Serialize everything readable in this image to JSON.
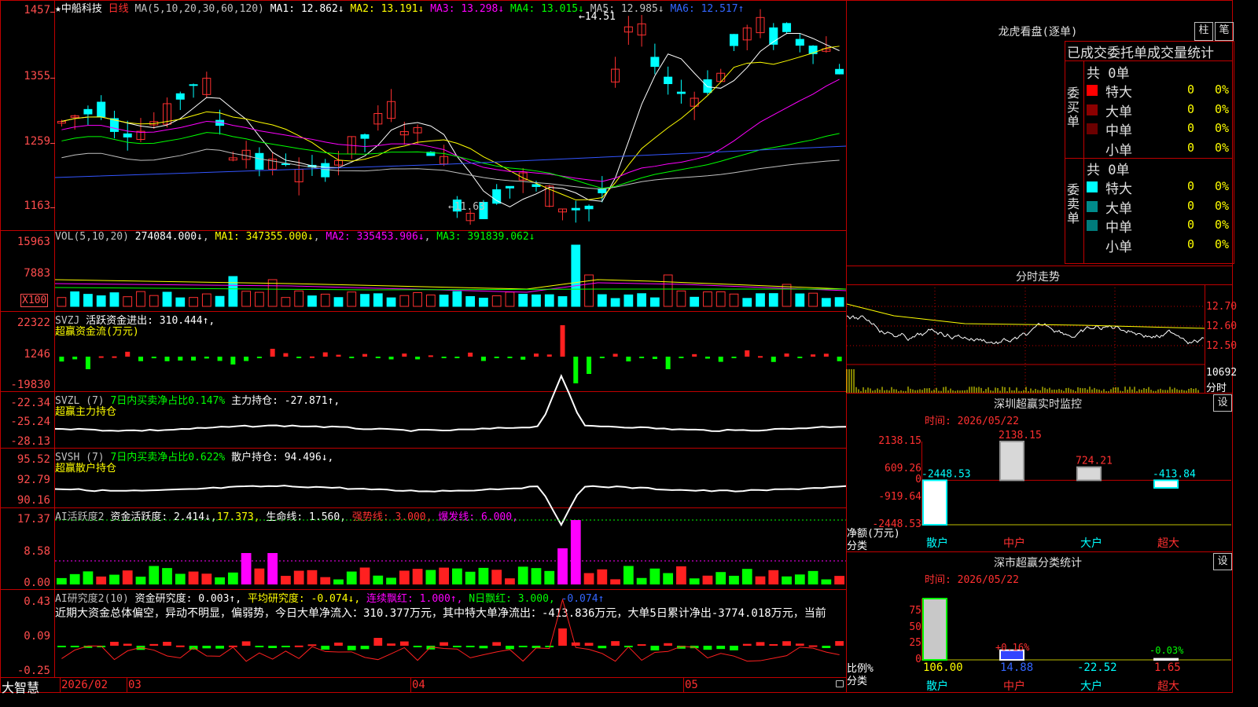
{
  "stock": {
    "star": "★",
    "name": "中船科技",
    "period": "日线"
  },
  "main": {
    "ma_params": "MA(5,10,20,30,60,120)",
    "ma": [
      {
        "label": "MA1: ",
        "value": "12.862↓",
        "color": "#ffffff"
      },
      {
        "label": "MA2: ",
        "value": "13.191↓",
        "color": "#ffff00"
      },
      {
        "label": "MA3: ",
        "value": "13.298↓",
        "color": "#ff00ff"
      },
      {
        "label": "MA4: ",
        "value": "13.015↓",
        "color": "#00ff00"
      },
      {
        "label": "MA5: ",
        "value": "12.985↓",
        "color": "#c0c0c0"
      },
      {
        "label": "MA6: ",
        "value": "12.517↑",
        "color": "#3366ff"
      }
    ],
    "yticks": [
      "1457",
      "1355",
      "1259",
      "1163"
    ],
    "high_label": "14.51",
    "low_label": "11.63"
  },
  "vol": {
    "params": "VOL(5,10,20)",
    "value": "274084.000↓",
    "ma1": "MA1: 347355.000↓",
    "ma2": "MA2: 335453.906↓",
    "ma3": "MA3: 391839.062↓",
    "yticks": [
      "15963",
      "7883"
    ],
    "unit": "X100"
  },
  "svzj": {
    "name": "SVZJ",
    "desc": "活跃资金进出: 310.444↑,",
    "sub": "超赢资金流(万元)",
    "yticks": [
      "22322",
      "1246",
      "-19830"
    ]
  },
  "svzl": {
    "name": "SVZL (7)",
    "pct": "7日内买卖净占比0.147%",
    "desc": "主力持仓: -27.871↑,",
    "sub": "超赢主力持仓",
    "yticks": [
      "-22.34",
      "-25.24",
      "-28.13"
    ]
  },
  "svsh": {
    "name": "SVSH (7)",
    "pct": "7日内买卖净占比0.622%",
    "desc": "散户持仓: 94.496↓,",
    "sub": "超赢散户持仓",
    "yticks": [
      "95.52",
      "92.79",
      "90.16"
    ]
  },
  "ai1": {
    "name": "AI活跃度2",
    "a": "资金活跃度: 2.414↓,",
    "b": "17.373,",
    "c": "生命线: 1.560,",
    "d": "强势线: 3.000,",
    "e": "爆发线: 6.000,",
    "yticks": [
      "17.37",
      "8.58",
      "0.00"
    ]
  },
  "ai2": {
    "name": "AI研究度2(10)",
    "a": "资金研究度: 0.003↑,",
    "b": "平均研究度: -0.074↓,",
    "c": "连续飘红: 1.000↑,",
    "d": "N日飘红: 3.000,",
    "e": "-0.074↑",
    "text": "近期大资金总体偏空，异动不明显，偏弱势，今日大单净流入：310.377万元，其中特大单净流出：-413.836万元，大单5日累计净出-3774.018万元，当前",
    "yticks": [
      "0.43",
      "0.09",
      "-0.25"
    ]
  },
  "xaxis": {
    "logo": "大智慧",
    "labels": [
      "2026/02",
      "03",
      "04",
      "05"
    ]
  },
  "lhb": {
    "title": "龙虎看盘(逐单)",
    "btn1": "柱",
    "btn2": "笔",
    "header": "已成交委托单成交量统计",
    "buy_side": "委买单",
    "sell_side": "委卖单",
    "buy_total": "共 0单",
    "sell_total": "共 0单",
    "buy_rows": [
      {
        "label": "特大",
        "n": "0",
        "pct": "0%",
        "color": "#ff0000"
      },
      {
        "label": "大单",
        "n": "0",
        "pct": "0%",
        "color": "#8b0000"
      },
      {
        "label": "中单",
        "n": "0",
        "pct": "0%",
        "color": "#6b0000"
      },
      {
        "label": "小单",
        "n": "0",
        "pct": "0%",
        "color": "#000000"
      }
    ],
    "sell_rows": [
      {
        "label": "特大",
        "n": "0",
        "pct": "0%",
        "color": "#00ffff"
      },
      {
        "label": "大单",
        "n": "0",
        "pct": "0%",
        "color": "#008b8b"
      },
      {
        "label": "中单",
        "n": "0",
        "pct": "0%",
        "color": "#007b7b"
      },
      {
        "label": "小单",
        "n": "0",
        "pct": "0%",
        "color": "#000000"
      }
    ]
  },
  "fenshi": {
    "title": "分时走势",
    "y1": "12.70",
    "y2": "12.60",
    "y3": "12.50",
    "vol": "10692",
    "vol_unit": "分时"
  },
  "szmon": {
    "title": "深圳超赢实时监控",
    "btn": "设",
    "time": "时间: 2026/05/22",
    "yticks": [
      "2138.15",
      "609.26",
      "0",
      "-919.64",
      "-2448.53"
    ],
    "ylabel1": "净额(万元)",
    "ylabel2": "分类",
    "bars": [
      {
        "cat": "散户",
        "value": -2448.53,
        "label": "-2448.53"
      },
      {
        "cat": "中户",
        "value": 2138.15,
        "label": "2138.15"
      },
      {
        "cat": "大户",
        "value": 724.21,
        "label": "724.21"
      },
      {
        "cat": "超大",
        "value": -413.84,
        "label": "-413.84"
      }
    ]
  },
  "szcls": {
    "title": "深市超赢分类统计",
    "btn": "设",
    "time": "时间: 2026/05/22",
    "yticks": [
      "75",
      "50",
      "25",
      "0"
    ],
    "ylabel1": "比例%",
    "ylabel2": "分类",
    "bars": [
      {
        "cat": "散户",
        "value": 106.0,
        "label": "106.00",
        "annot": ""
      },
      {
        "cat": "中户",
        "value": 14.88,
        "label": "14.88",
        "annot": "+0.16%"
      },
      {
        "cat": "大户",
        "value": -22.52,
        "label": "-22.52",
        "annot": ""
      },
      {
        "cat": "超大",
        "value": 1.65,
        "label": "1.65",
        "annot": "-0.03%"
      }
    ]
  },
  "chart_data": [
    {
      "type": "bar",
      "title": "深圳超赢实时监控",
      "categories": [
        "散户",
        "中户",
        "大户",
        "超大"
      ],
      "values": [
        -2448.53,
        2138.15,
        724.21,
        -413.84
      ],
      "ylim": [
        -2448.53,
        2138.15
      ]
    },
    {
      "type": "bar",
      "title": "深市超赢分类统计",
      "categories": [
        "散户",
        "中户",
        "大户",
        "超大"
      ],
      "values": [
        106.0,
        14.88,
        -22.52,
        1.65
      ],
      "ylim": [
        0,
        75
      ]
    }
  ]
}
